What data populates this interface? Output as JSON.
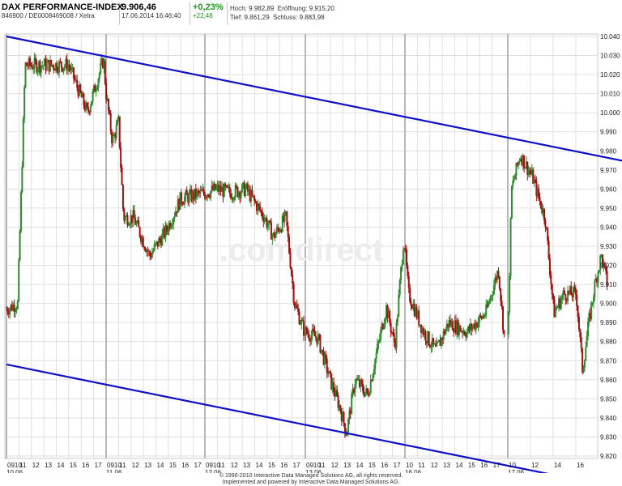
{
  "header": {
    "index_name": "DAX PERFORMANCE-INDEX",
    "identifier": "846900 / DE0008469008 / Xetra",
    "price": "9.906,46",
    "datetime": "17.06.2014 16:46:40",
    "change_pct": "+0,23%",
    "change_abs": "+22,48",
    "high_label": "Hoch:",
    "high_value": "9.982,89",
    "low_label": "Tief:",
    "low_value": "9.861,29",
    "open_label": "Eröffnung:",
    "open_value": "9.915,20",
    "close_label": "Schluss:",
    "close_value": "9.883,98"
  },
  "watermark": ".comdirect",
  "footer": {
    "line1": "© 1996-2010 Interactive Data Managed Solutions AG, all rights reserved.",
    "line2": "Implemented and powered by Interactive Data Managed Solutions AG."
  },
  "colors": {
    "up_candle": "#2e8b2e",
    "down_candle": "#a01010",
    "trendline": "#1010c8",
    "grid": "#e0e0e0",
    "day_separator": "#b8b8b8"
  },
  "chart_data": {
    "type": "candlestick",
    "title": "DAX PERFORMANCE-INDEX",
    "ylim": [
      9820,
      10040
    ],
    "y_ticks": [
      "9.820",
      "9.830",
      "9.840",
      "9.850",
      "9.860",
      "9.870",
      "9.880",
      "9.890",
      "9.900",
      "9.910",
      "9.920",
      "9.930",
      "9.940",
      "9.950",
      "9.960",
      "9.970",
      "9.980",
      "9.990",
      "10.000",
      "10.010",
      "10.020",
      "10.030",
      "10.040"
    ],
    "grid": true,
    "days": [
      {
        "date": "10.06.",
        "hours": [
          "0910",
          "11",
          "12",
          "13",
          "14",
          "15",
          "16",
          "17"
        ]
      },
      {
        "date": "11.06.",
        "hours": [
          "0910",
          "11",
          "12",
          "13",
          "14",
          "15",
          "16",
          "17"
        ]
      },
      {
        "date": "12.06.",
        "hours": [
          "0910",
          "11",
          "12",
          "13",
          "14",
          "15",
          "16",
          "17"
        ]
      },
      {
        "date": "13.06.",
        "hours": [
          "0910",
          "11",
          "12",
          "13",
          "14",
          "15",
          "16",
          "17"
        ]
      },
      {
        "date": "16.06.",
        "hours": [
          "10",
          "11",
          "12",
          "13",
          "14",
          "15",
          "16",
          "17"
        ]
      },
      {
        "date": "17.06.",
        "hours": [
          "10",
          "12",
          "14",
          "16"
        ]
      }
    ],
    "price_path": [
      {
        "t": 0.0,
        "v": 9897
      },
      {
        "t": 0.9,
        "v": 9900
      },
      {
        "t": 1.5,
        "v": 10025
      },
      {
        "t": 3.0,
        "v": 10025
      },
      {
        "t": 5.0,
        "v": 10025
      },
      {
        "t": 6.5,
        "v": 10000
      },
      {
        "t": 7.8,
        "v": 10028
      },
      {
        "t": 8.0,
        "v": 10010
      },
      {
        "t": 8.5,
        "v": 9985
      },
      {
        "t": 9.0,
        "v": 9995
      },
      {
        "t": 9.4,
        "v": 9945
      },
      {
        "t": 10.2,
        "v": 9945
      },
      {
        "t": 11.5,
        "v": 9925
      },
      {
        "t": 12.8,
        "v": 9938
      },
      {
        "t": 14.0,
        "v": 9955
      },
      {
        "t": 16.0,
        "v": 9958
      },
      {
        "t": 17.0,
        "v": 9960
      },
      {
        "t": 18.0,
        "v": 9958
      },
      {
        "t": 19.3,
        "v": 9960
      },
      {
        "t": 20.8,
        "v": 9945
      },
      {
        "t": 21.5,
        "v": 9935
      },
      {
        "t": 22.5,
        "v": 9945
      },
      {
        "t": 23.2,
        "v": 9900
      },
      {
        "t": 24.0,
        "v": 9885
      },
      {
        "t": 25.0,
        "v": 9882
      },
      {
        "t": 26.0,
        "v": 9860
      },
      {
        "t": 26.8,
        "v": 9845
      },
      {
        "t": 27.3,
        "v": 9832
      },
      {
        "t": 28.0,
        "v": 9860
      },
      {
        "t": 29.0,
        "v": 9852
      },
      {
        "t": 30.5,
        "v": 9898
      },
      {
        "t": 31.2,
        "v": 9878
      },
      {
        "t": 31.9,
        "v": 9935
      },
      {
        "t": 32.3,
        "v": 9905
      },
      {
        "t": 33.5,
        "v": 9885
      },
      {
        "t": 34.5,
        "v": 9875
      },
      {
        "t": 35.5,
        "v": 9890
      },
      {
        "t": 37.0,
        "v": 9885
      },
      {
        "t": 38.5,
        "v": 9895
      },
      {
        "t": 39.5,
        "v": 9918
      },
      {
        "t": 40.0,
        "v": 9880
      },
      {
        "t": 40.3,
        "v": 9960
      },
      {
        "t": 41.0,
        "v": 9978
      },
      {
        "t": 42.0,
        "v": 9966
      },
      {
        "t": 42.5,
        "v": 9955
      },
      {
        "t": 43.0,
        "v": 9945
      },
      {
        "t": 43.7,
        "v": 9895
      },
      {
        "t": 44.5,
        "v": 9905
      },
      {
        "t": 45.5,
        "v": 9905
      },
      {
        "t": 46.0,
        "v": 9865
      },
      {
        "t": 46.5,
        "v": 9890
      },
      {
        "t": 47.0,
        "v": 9910
      },
      {
        "t": 47.5,
        "v": 9925
      },
      {
        "t": 48.0,
        "v": 9910
      }
    ],
    "trendlines": [
      {
        "name": "upper",
        "x": [
          0,
          48
        ],
        "y": [
          10040,
          9974
        ]
      },
      {
        "name": "lower",
        "x": [
          0,
          48
        ],
        "y": [
          9868,
          9802
        ]
      }
    ]
  }
}
